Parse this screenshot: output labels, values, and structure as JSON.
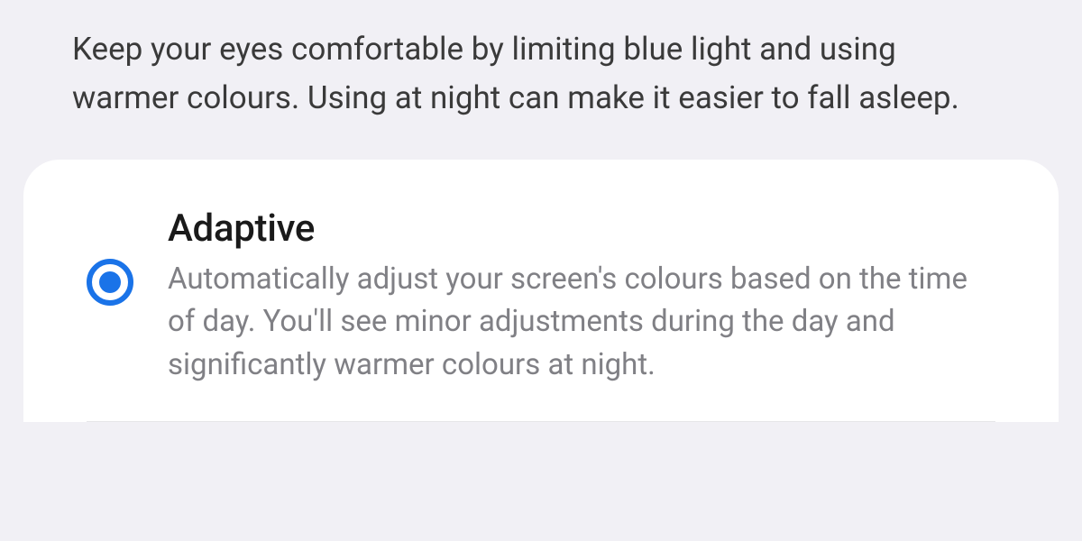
{
  "header": {
    "description": "Keep your eyes comfortable by limiting blue light and using warmer colours. Using at night can make it easier to fall asleep."
  },
  "options": {
    "adaptive": {
      "title": "Adaptive",
      "description": "Automatically adjust your screen's colours based on the time of day. You'll see minor adjustments during the day and significantly warmer colours at night.",
      "selected": true
    }
  },
  "colors": {
    "accent": "#1a73e8",
    "background": "#f1f0f5",
    "card": "#ffffff",
    "text_primary": "#1a1a1a",
    "text_secondary": "#808085"
  }
}
